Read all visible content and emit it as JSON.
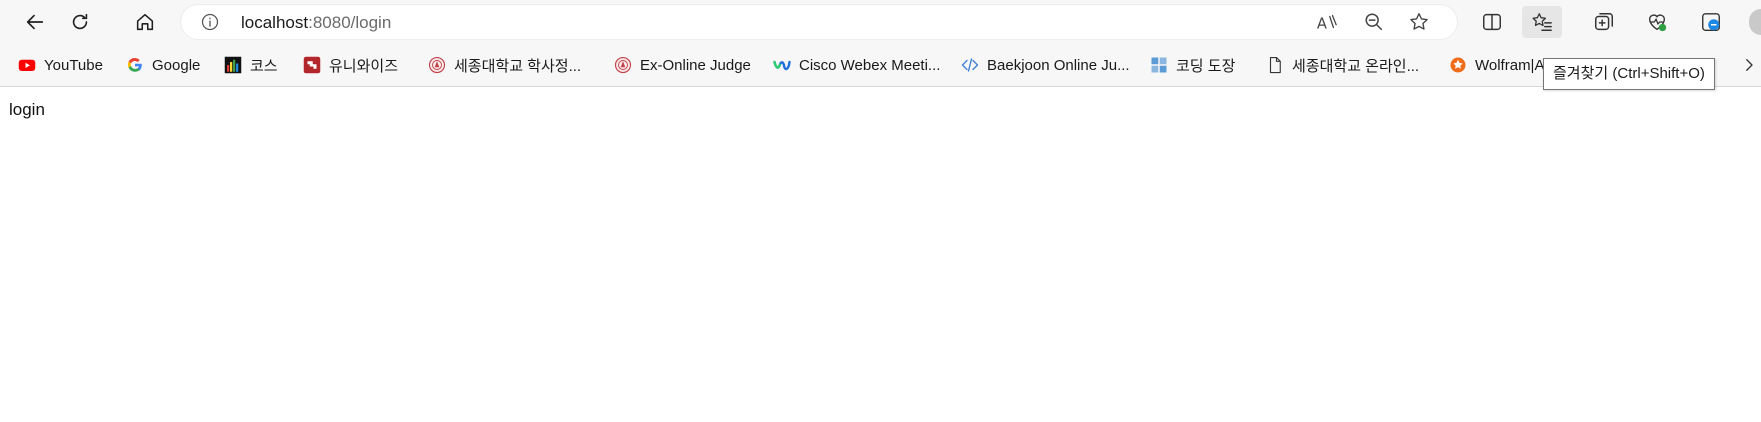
{
  "browser": {
    "url_host": "localhost",
    "url_path": ":8080/login",
    "tooltip": "즐겨찾기 (Ctrl+Shift+O)"
  },
  "bookmarks": [
    {
      "label": "YouTube",
      "icon": "youtube-icon"
    },
    {
      "label": "Google",
      "icon": "google-icon"
    },
    {
      "label": "코스",
      "icon": "bar-chart-icon"
    },
    {
      "label": "유니와이즈",
      "icon": "uniwise-icon"
    },
    {
      "label": "세종대학교 학사정...",
      "icon": "sejong-emblem-icon"
    },
    {
      "label": "Ex-Online Judge",
      "icon": "sejong-emblem-icon"
    },
    {
      "label": "Cisco Webex Meeti...",
      "icon": "webex-icon"
    },
    {
      "label": "Baekjoon Online Ju...",
      "icon": "code-icon"
    },
    {
      "label": "코딩 도장",
      "icon": "dojang-icon"
    },
    {
      "label": "세종대학교 온라인...",
      "icon": "document-icon"
    },
    {
      "label": "Wolfram|A",
      "icon": "wolfram-icon"
    }
  ],
  "page": {
    "body_text": "login"
  },
  "colors": {
    "chrome_bg": "#f7f7f7",
    "youtube_red": "#ff0000",
    "webex_blue": "#1e6fd9",
    "wolfram_orange": "#ef6c1a"
  }
}
